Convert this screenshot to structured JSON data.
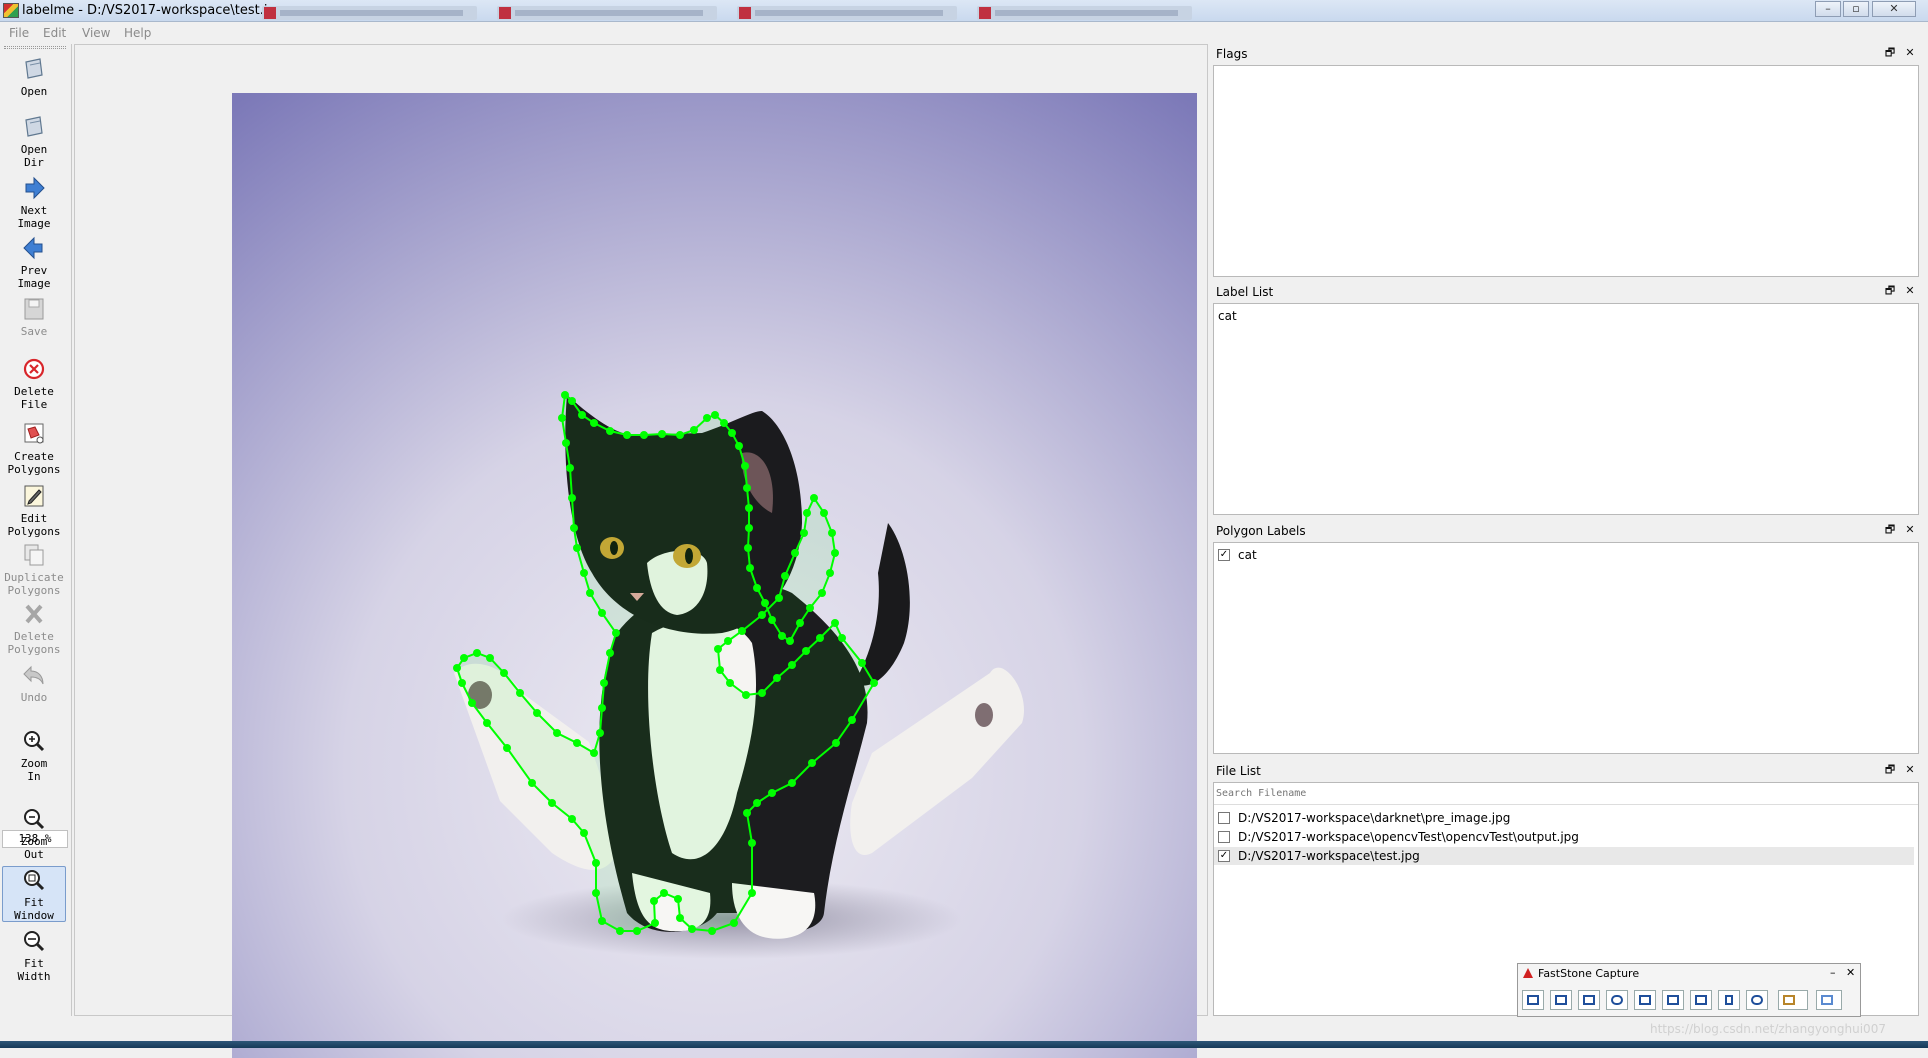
{
  "window": {
    "title": "labelme - D:/VS2017-workspace\\test.jpg",
    "controls": {
      "minimize": "–",
      "maximize": "▫",
      "close": "✕"
    }
  },
  "menu": [
    "File",
    "Edit",
    "View",
    "Help"
  ],
  "toolbar": {
    "open": "Open",
    "open_dir": "Open Dir",
    "next_image": "Next Image",
    "prev_image": "Prev Image",
    "save": "Save",
    "delete_file": "Delete File",
    "create_polygons": "Create Polygons",
    "edit_polygons": "Edit Polygons",
    "duplicate_polygons": "Duplicate Polygons",
    "delete_polygons": "Delete Polygons",
    "undo": "Undo",
    "zoom_in": "Zoom In",
    "zoom_value": "138 %",
    "zoom_out": "Zoom Out",
    "fit_window": "Fit Window",
    "fit_width": "Fit Width"
  },
  "docks": {
    "flags": {
      "title": "Flags"
    },
    "label_list": {
      "title": "Label List",
      "items": [
        "cat"
      ]
    },
    "polygon_labels": {
      "title": "Polygon Labels",
      "items": [
        {
          "label": "cat",
          "checked": true
        }
      ]
    },
    "file_list": {
      "title": "File List",
      "search_placeholder": "Search Filename",
      "files": [
        {
          "path": "D:/VS2017-workspace\\darknet\\pre_image.jpg",
          "checked": false
        },
        {
          "path": "D:/VS2017-workspace\\opencvTest\\opencvTest\\output.jpg",
          "checked": false
        },
        {
          "path": "D:/VS2017-workspace\\test.jpg",
          "checked": true
        }
      ]
    },
    "float_icon": "🗗",
    "close_icon": "✕"
  },
  "faststone": {
    "title": "FastStone Capture",
    "minimize": "–",
    "close": "✕"
  },
  "watermark": "https://blog.csdn.net/zhangyonghui007",
  "colors": {
    "polygon": "#00ff00",
    "background_top": "#7b78b8",
    "background_center": "#e2e0ec"
  }
}
